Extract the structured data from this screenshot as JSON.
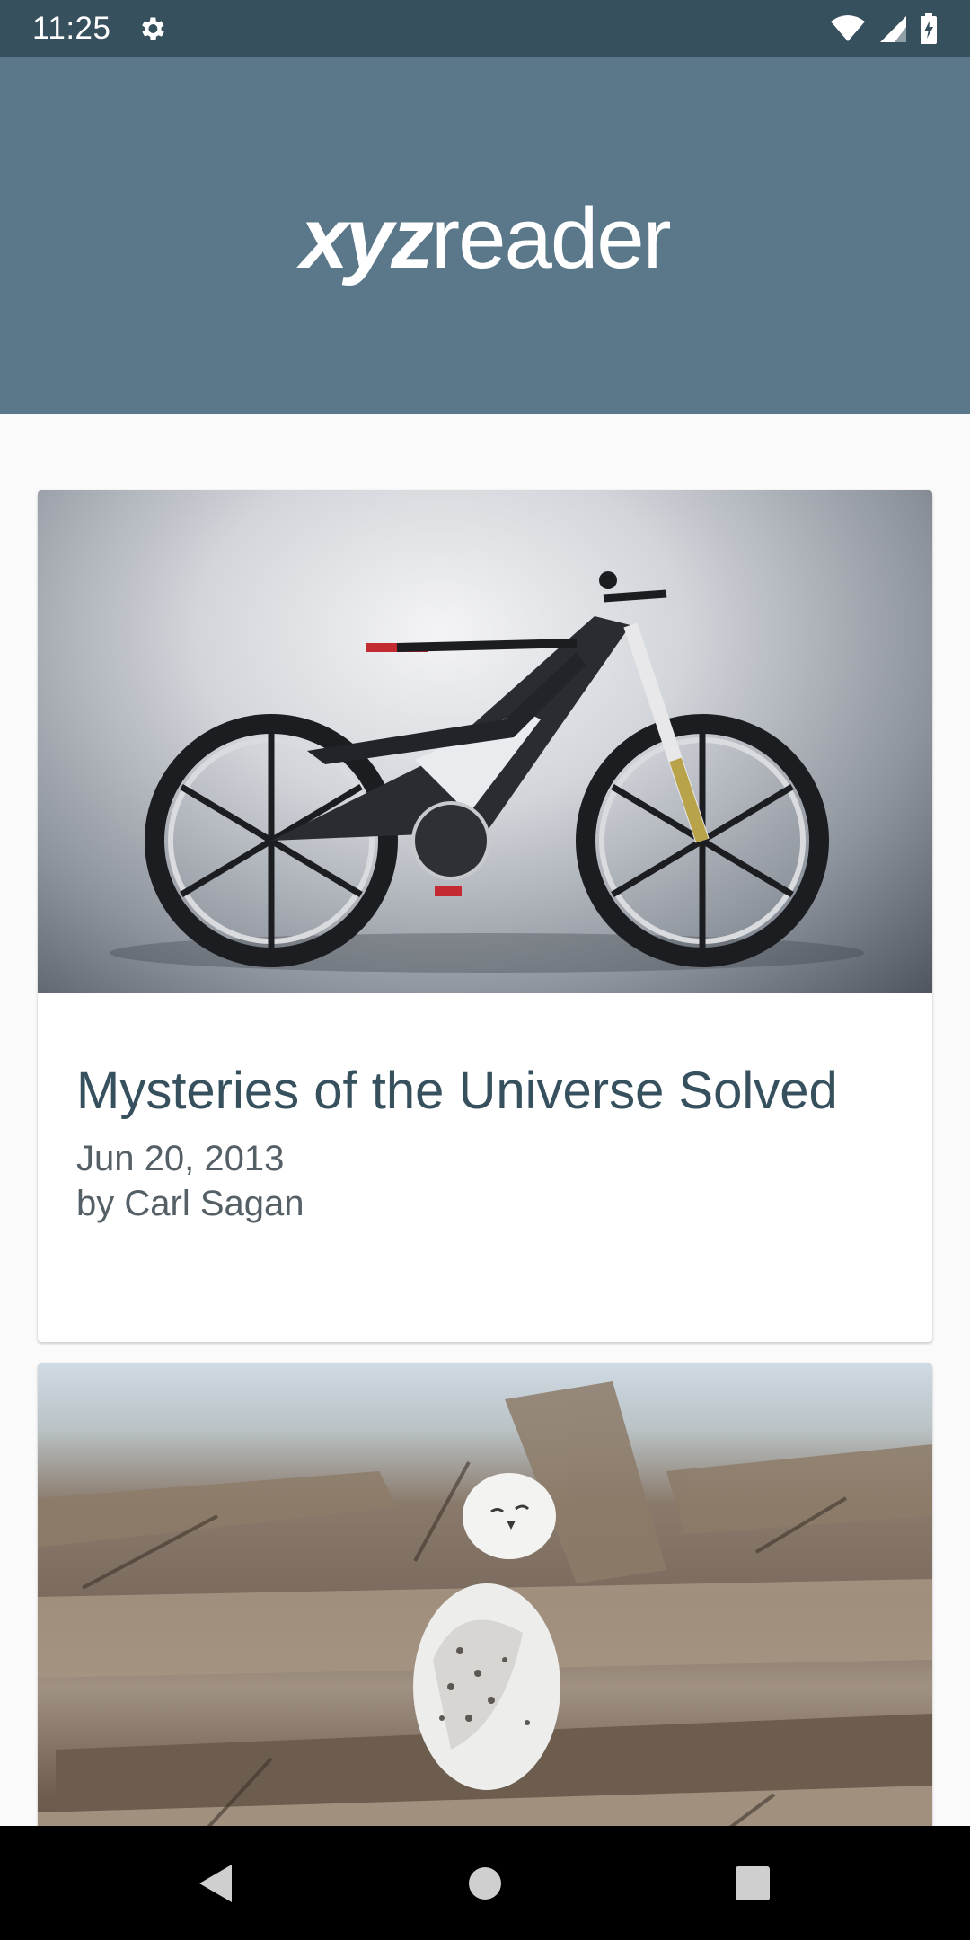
{
  "status_bar": {
    "time": "11:25",
    "icons": [
      "gear-icon",
      "wifi-icon",
      "signal-icon",
      "battery-charging-icon"
    ]
  },
  "header": {
    "logo_bold": "xyz",
    "logo_light": "reader",
    "background": "#5a7889"
  },
  "articles": [
    {
      "title": "Mysteries of the Universe Solved",
      "date": "Jun 20, 2013",
      "author": "by Carl Sagan",
      "image": "electric-bike-photo"
    },
    {
      "title": "",
      "date": "",
      "author": "",
      "image": "snowy-owl-photo"
    }
  ],
  "nav_bar": {
    "buttons": [
      "back-icon",
      "home-icon",
      "recents-icon"
    ]
  },
  "colors": {
    "status_bar": "#37505e",
    "header": "#5a7889",
    "title_text": "#37505e",
    "meta_text": "#555f66",
    "background": "#fafafa"
  }
}
